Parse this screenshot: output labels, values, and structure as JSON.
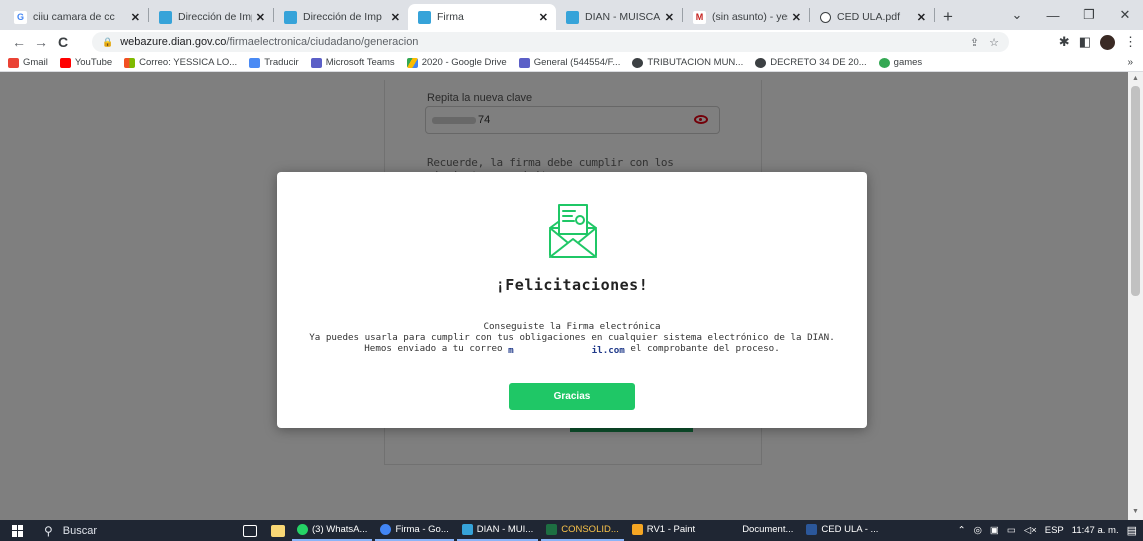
{
  "browser": {
    "tabs": [
      {
        "label": "ciiu camara de cc",
        "icon": "google-icon",
        "color": "#4285f4",
        "active": false
      },
      {
        "label": "Dirección de Imp",
        "icon": "dian-icon",
        "color": "#36a3d9",
        "active": false
      },
      {
        "label": "Dirección de Imp",
        "icon": "dian-icon",
        "color": "#36a3d9",
        "active": false
      },
      {
        "label": "Firma",
        "icon": "dian-icon",
        "color": "#36a3d9",
        "active": true
      },
      {
        "label": "DIAN - MUISCA",
        "icon": "dian-icon",
        "color": "#36a3d9",
        "active": false
      },
      {
        "label": "(sin asunto) - yes",
        "icon": "gmail-icon",
        "color": "#c5221f",
        "active": false
      },
      {
        "label": "CED ULA.pdf",
        "icon": "globe-icon",
        "color": "#5f6368",
        "active": false
      }
    ],
    "new_tab": "+",
    "window_controls": {
      "dropdown": "⌄",
      "minimize": "—",
      "restore": "❐",
      "close": "✕"
    },
    "nav": {
      "back": "←",
      "forward": "→",
      "reload": "C"
    },
    "address": {
      "domain": "webazure.dian.gov.co",
      "path": "/firmaelectronica/ciudadano/generacion"
    },
    "bookmarks": [
      {
        "label": "Gmail",
        "icon": "gmail-icon",
        "color": "#ea4335"
      },
      {
        "label": "YouTube",
        "icon": "youtube-icon",
        "color": "#ff0000"
      },
      {
        "label": "Correo: YESSICA LO...",
        "icon": "outlook-icon",
        "color": "#f25022"
      },
      {
        "label": "Traducir",
        "icon": "translate-icon",
        "color": "#4a8af4"
      },
      {
        "label": "Microsoft Teams",
        "icon": "teams-icon",
        "color": "#5b5fc7"
      },
      {
        "label": "2020 - Google Drive",
        "icon": "drive-icon",
        "color": "#fbbc04"
      },
      {
        "label": "General (544554/F...",
        "icon": "teams-icon",
        "color": "#5b5fc7"
      },
      {
        "label": "TRIBUTACION MUN...",
        "icon": "globe-icon",
        "color": "#3c4043"
      },
      {
        "label": "DECRETO 34 DE 20...",
        "icon": "globe-icon",
        "color": "#3c4043"
      },
      {
        "label": "games",
        "icon": "games-icon",
        "color": "#34a853"
      }
    ],
    "bookmarks_more": "»"
  },
  "background_form": {
    "label": "Repita la nueva clave",
    "password_suffix": "74",
    "note": "Recuerde, la firma debe cumplir con los siguientes requisitos:"
  },
  "modal": {
    "title": "¡Felicitaciones!",
    "line1": "Conseguiste la Firma electrónica",
    "line2": "Ya puedes usarla para cumplir con tus obligaciones en cualquier sistema electrónico de la DIAN.",
    "line3_prefix": "Hemos enviado a tu correo",
    "email_start": "m",
    "email_end": "il.com",
    "line3_suffix": "el comprobante del proceso.",
    "button": "Gracias",
    "accent": "#1fc766",
    "icon": "envelope-letter-icon"
  },
  "taskbar": {
    "search_placeholder": "Buscar",
    "apps": [
      {
        "label": "(3) WhatsA...",
        "color": "#25d366"
      },
      {
        "label": "Firma - Go...",
        "color": "#4285f4"
      },
      {
        "label": "DIAN - MUI...",
        "color": "#36a3d9"
      },
      {
        "label": "CONSOLID...",
        "color": "#1d6f42"
      },
      {
        "label": "RV1 - Paint",
        "color": "#f5a623"
      },
      {
        "label": "Document...",
        "color": "#2b579a"
      },
      {
        "label": "CED ULA - ...",
        "color": "#2b579a"
      }
    ],
    "lang": "ESP",
    "time": "11:47 a. m."
  }
}
